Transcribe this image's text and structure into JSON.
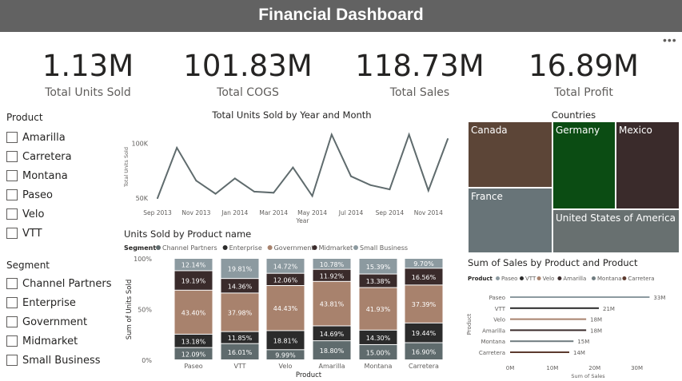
{
  "header": {
    "title": "Financial Dashboard",
    "more_icon": "more-options-icon"
  },
  "kpis": [
    {
      "value": "1.13M",
      "label": "Total Units Sold"
    },
    {
      "value": "101.83M",
      "label": "Total COGS"
    },
    {
      "value": "118.73M",
      "label": "Total Sales"
    },
    {
      "value": "16.89M",
      "label": "Total Profit"
    }
  ],
  "slicers": {
    "product": {
      "title": "Product",
      "items": [
        "Amarilla",
        "Carretera",
        "Montana",
        "Paseo",
        "Velo",
        "VTT"
      ]
    },
    "segment": {
      "title": "Segment",
      "items": [
        "Channel Partners",
        "Enterprise",
        "Government",
        "Midmarket",
        "Small Business"
      ]
    }
  },
  "colors": {
    "line": "#5f6b6d",
    "channel_partners": "#5f6b6d",
    "enterprise": "#2b2b2b",
    "government": "#a8826d",
    "midmarket": "#3a2b2b",
    "small_business": "#8c9aa0",
    "canada": "#5c4537",
    "germany": "#0b4c13",
    "mexico": "#3a2b2b",
    "france": "#687478",
    "usa": "#687070"
  },
  "chart_data": [
    {
      "type": "line",
      "title": "Total Units Sold by Year and Month",
      "xlabel": "Year",
      "ylabel": "Total Units Sold",
      "x": [
        "Sep 2013",
        "Oct 2013",
        "Nov 2013",
        "Dec 2013",
        "Jan 2014",
        "Feb 2014",
        "Mar 2014",
        "Apr 2014",
        "May 2014",
        "Jun 2014",
        "Jul 2014",
        "Aug 2014",
        "Sep 2014",
        "Oct 2014",
        "Nov 2014",
        "Dec 2014"
      ],
      "x_tick_labels": [
        "Sep 2013",
        "Nov 2013",
        "Jan 2014",
        "Mar 2014",
        "May 2014",
        "Jul 2014",
        "Sep 2014",
        "Nov 2014"
      ],
      "values": [
        50000,
        96000,
        66000,
        54000,
        68000,
        56000,
        55000,
        78000,
        52000,
        108000,
        70000,
        62000,
        58000,
        108000,
        57000,
        104000
      ],
      "y_tick_labels": [
        "50K",
        "100K"
      ],
      "y_ticks": [
        50000,
        100000
      ],
      "ylim": [
        45000,
        112000
      ],
      "grid": false
    },
    {
      "type": "bar",
      "stacked": "100%",
      "title": "Units Sold by Product name",
      "legend_title": "Segment",
      "legend_position": "top",
      "xlabel": "Product",
      "ylabel": "Sum of Units Sold",
      "y_tick_labels": [
        "0%",
        "50%",
        "100%"
      ],
      "categories": [
        "Paseo",
        "VTT",
        "Velo",
        "Amarilla",
        "Montana",
        "Carretera"
      ],
      "series": [
        {
          "name": "Channel Partners",
          "color": "#5f6b6d",
          "values": [
            12.09,
            16.01,
            9.99,
            18.8,
            15.0,
            16.9
          ],
          "labels": [
            "12.09%",
            "16.01%",
            "9.99%",
            "18.80%",
            "15.00%",
            "16.90%"
          ]
        },
        {
          "name": "Enterprise",
          "color": "#2b2b2b",
          "values": [
            13.18,
            11.85,
            18.81,
            14.69,
            14.3,
            19.44
          ],
          "labels": [
            "13.18%",
            "11.85%",
            "18.81%",
            "14.69%",
            "14.30%",
            "19.44%"
          ]
        },
        {
          "name": "Government",
          "color": "#a8826d",
          "values": [
            43.4,
            37.98,
            44.43,
            43.81,
            41.93,
            37.39
          ],
          "labels": [
            "43.40%",
            "37.98%",
            "44.43%",
            "43.81%",
            "41.93%",
            "37.39%"
          ]
        },
        {
          "name": "Midmarket",
          "color": "#3a2b2b",
          "values": [
            19.19,
            14.36,
            12.06,
            11.92,
            13.38,
            16.56
          ],
          "labels": [
            "19.19%",
            "14.36%",
            "12.06%",
            "11.92%",
            "13.38%",
            "16.56%"
          ]
        },
        {
          "name": "Small Business",
          "color": "#8c9aa0",
          "values": [
            12.14,
            19.81,
            14.72,
            10.78,
            15.39,
            9.7
          ],
          "labels": [
            "12.14%",
            "19.81%",
            "14.72%",
            "10.78%",
            "15.39%",
            "9.70%"
          ]
        }
      ]
    },
    {
      "type": "treemap",
      "title": "Countries",
      "categories": [
        "Canada",
        "Germany",
        "Mexico",
        "France",
        "United States of America"
      ]
    },
    {
      "type": "bar",
      "orientation": "horizontal",
      "title": "Sum of Sales by Product and Product",
      "legend_title": "Product",
      "legend_position": "top",
      "legend": [
        "Paseo",
        "VTT",
        "Velo",
        "Amarilla",
        "Montana",
        "Carretera"
      ],
      "xlabel": "Sum of Sales",
      "ylabel": "Product",
      "x_tick_labels": [
        "0M",
        "10M",
        "20M",
        "30M"
      ],
      "xlim": [
        0,
        35
      ],
      "categories": [
        "Paseo",
        "VTT",
        "Velo",
        "Amarilla",
        "Montana",
        "Carretera"
      ],
      "values": [
        33,
        21,
        18,
        18,
        15,
        14
      ],
      "value_labels": [
        "33M",
        "21M",
        "18M",
        "18M",
        "15M",
        "14M"
      ],
      "colors": [
        "#8c9aa0",
        "#2b2b2b",
        "#a8826d",
        "#3a2b2b",
        "#6f7c80",
        "#5c3a2e"
      ]
    }
  ]
}
